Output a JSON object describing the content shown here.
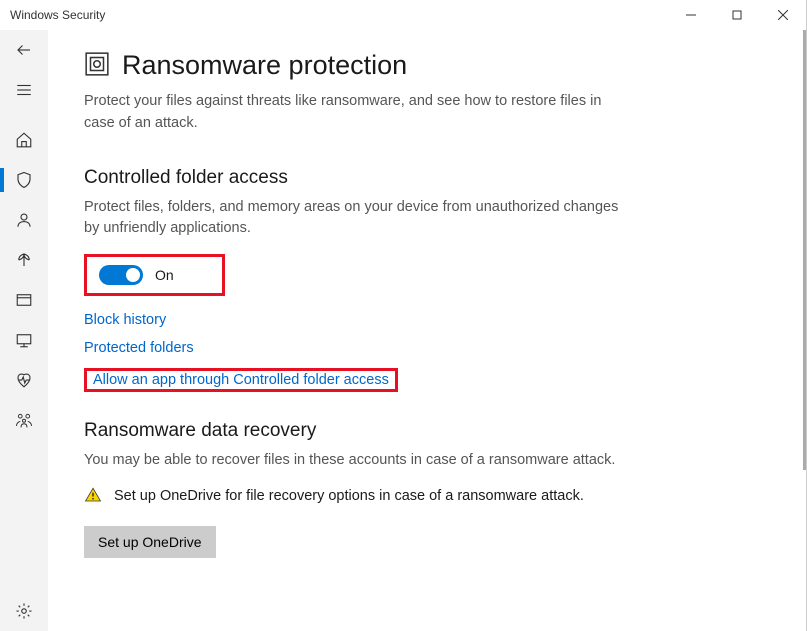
{
  "window": {
    "title": "Windows Security"
  },
  "rail": {
    "items": [
      {
        "name": "back",
        "selected": false
      },
      {
        "name": "menu",
        "selected": false
      },
      {
        "name": "home",
        "selected": false
      },
      {
        "name": "virus-threat",
        "selected": true
      },
      {
        "name": "account",
        "selected": false
      },
      {
        "name": "firewall",
        "selected": false
      },
      {
        "name": "app-browser",
        "selected": false
      },
      {
        "name": "device-security",
        "selected": false
      },
      {
        "name": "performance",
        "selected": false
      },
      {
        "name": "family",
        "selected": false
      }
    ],
    "settings": {
      "name": "settings"
    }
  },
  "page": {
    "title": "Ransomware protection",
    "subtitle": "Protect your files against threats like ransomware, and see how to restore files in case of an attack."
  },
  "cfa": {
    "title": "Controlled folder access",
    "desc": "Protect files, folders, and memory areas on your device from unauthorized changes by unfriendly applications.",
    "toggle_label": "On",
    "toggle_state": "on",
    "links": {
      "block_history": "Block history",
      "protected_folders": "Protected folders",
      "allow_app": "Allow an app through Controlled folder access"
    }
  },
  "recovery": {
    "title": "Ransomware data recovery",
    "desc": "You may be able to recover files in these accounts in case of a ransomware attack.",
    "warn": "Set up OneDrive for file recovery options in case of a ransomware attack.",
    "button": "Set up OneDrive"
  },
  "annotations": {
    "highlight_toggle": true,
    "highlight_allow_link": true
  }
}
